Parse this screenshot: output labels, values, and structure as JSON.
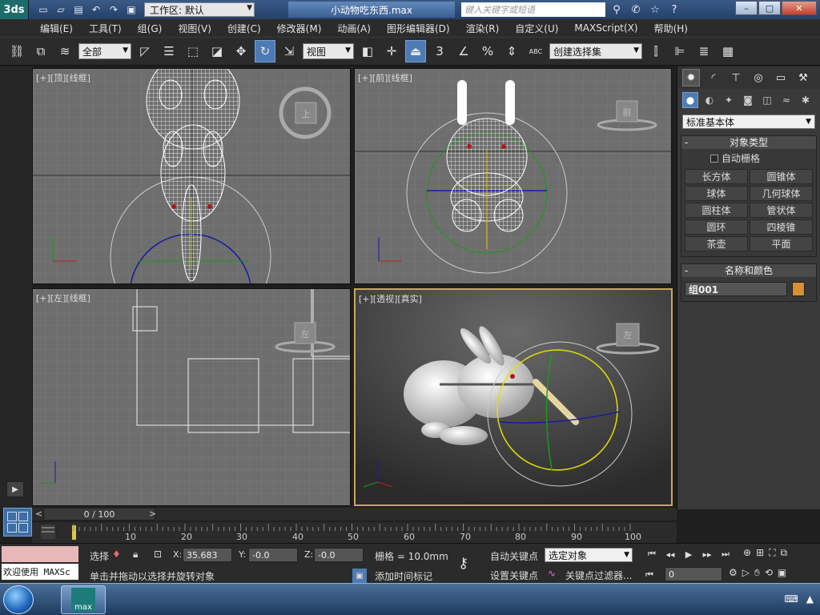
{
  "app": {
    "logo": "3ds",
    "workspace_label": "工作区: 默认",
    "doc_title": "小动物吃东西.max",
    "search_placeholder": "键入关键字或短语"
  },
  "menu": [
    "编辑(E)",
    "工具(T)",
    "组(G)",
    "视图(V)",
    "创建(C)",
    "修改器(M)",
    "动画(A)",
    "图形编辑器(D)",
    "渲染(R)",
    "自定义(U)",
    "MAXScript(X)",
    "帮助(H)"
  ],
  "toolbar": {
    "filter_select": "全部",
    "coord_select": "视图",
    "named_selection": "创建选择集",
    "snap_3": "3",
    "percent": "%",
    "abc": "ABC"
  },
  "viewports": {
    "top": {
      "label": "[+][顶][线框]",
      "cube": "上"
    },
    "front": {
      "label": "[+][前][线框]",
      "cube": "前"
    },
    "left": {
      "label": "[+][左][线框]",
      "cube": "左"
    },
    "persp": {
      "label": "[+][透视][真实]",
      "cube": "左"
    }
  },
  "cmd_panel": {
    "category": "标准基本体",
    "object_type_header": "对象类型",
    "autogrid": "自动栅格",
    "primitives": [
      "长方体",
      "圆锥体",
      "球体",
      "几何球体",
      "圆柱体",
      "管状体",
      "圆环",
      "四棱锥",
      "茶壶",
      "平面"
    ],
    "name_color_header": "名称和颜色",
    "object_name": "组001",
    "object_color": "#d89030"
  },
  "timeline": {
    "frame_display": "0 / 100",
    "ticks": [
      "10",
      "20",
      "30",
      "40",
      "50",
      "60",
      "70",
      "80",
      "90",
      "100"
    ]
  },
  "status": {
    "maxscript_label": "欢迎使用 MAXSc",
    "selection_label": "选择",
    "x_label": "X:",
    "x_value": "35.683",
    "y_label": "Y:",
    "y_value": "-0.0",
    "z_label": "Z:",
    "z_value": "-0.0",
    "grid": "栅格 = 10.0mm",
    "prompt": "单击并拖动以选择并旋转对象",
    "add_time_tag": "添加时间标记",
    "auto_key": "自动关键点",
    "set_key": "设置关键点",
    "key_mode_select": "选定对象",
    "key_filters": "关键点过滤器...",
    "current_frame": "0"
  },
  "taskbar": {
    "app_label": "max"
  }
}
